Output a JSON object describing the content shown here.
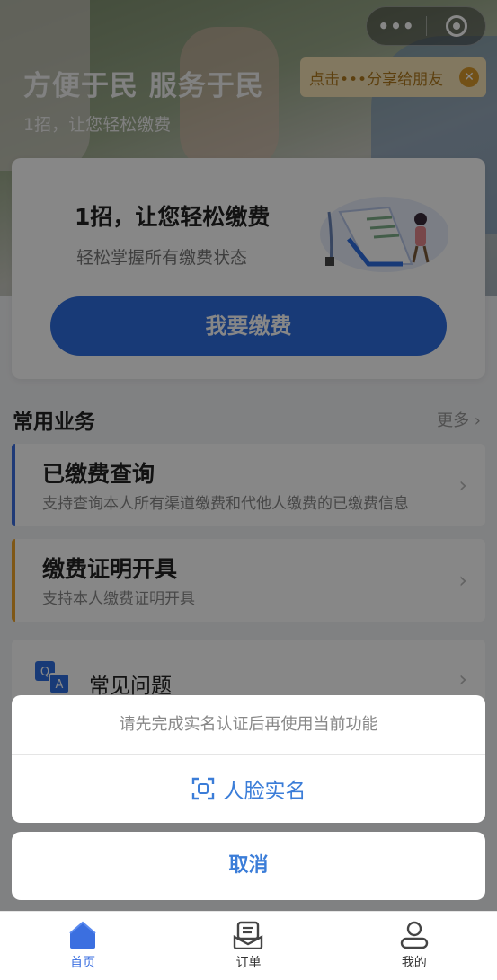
{
  "hero": {
    "title": "方便于民 服务于民",
    "subtitle": "1招，让您轻松缴费"
  },
  "capsule": {
    "more_label": "•••",
    "more_icon": "more-dots-icon",
    "close_icon": "target-ring-icon"
  },
  "share_tip": {
    "text": "点击•••分享给朋友",
    "close_label": "✕"
  },
  "main_card": {
    "title": "1招，让您轻松缴费",
    "desc": "轻松掌握所有缴费状态",
    "button": "我要缴费"
  },
  "section": {
    "title": "常用业务",
    "more": "更多"
  },
  "services": [
    {
      "title": "已缴费查询",
      "desc": "支持查询本人所有渠道缴费和代他人缴费的已缴费信息",
      "accent": "#3b6fe0"
    },
    {
      "title": "缴费证明开具",
      "desc": "支持本人缴费证明开具",
      "accent": "#f0a52a"
    }
  ],
  "faq": {
    "title": "常见问题",
    "icon": "qa-icon"
  },
  "sheet": {
    "message": "请先完成实名认证后再使用当前功能",
    "face_label": "人脸实名",
    "cancel": "取消"
  },
  "tabbar": [
    {
      "label": "首页",
      "icon": "home-icon",
      "active": true
    },
    {
      "label": "订单",
      "icon": "order-icon",
      "active": false
    },
    {
      "label": "我的",
      "icon": "user-icon",
      "active": false
    }
  ],
  "colors": {
    "primary": "#2f6fe0",
    "link": "#3b7dd8",
    "warning": "#f0a52a"
  }
}
